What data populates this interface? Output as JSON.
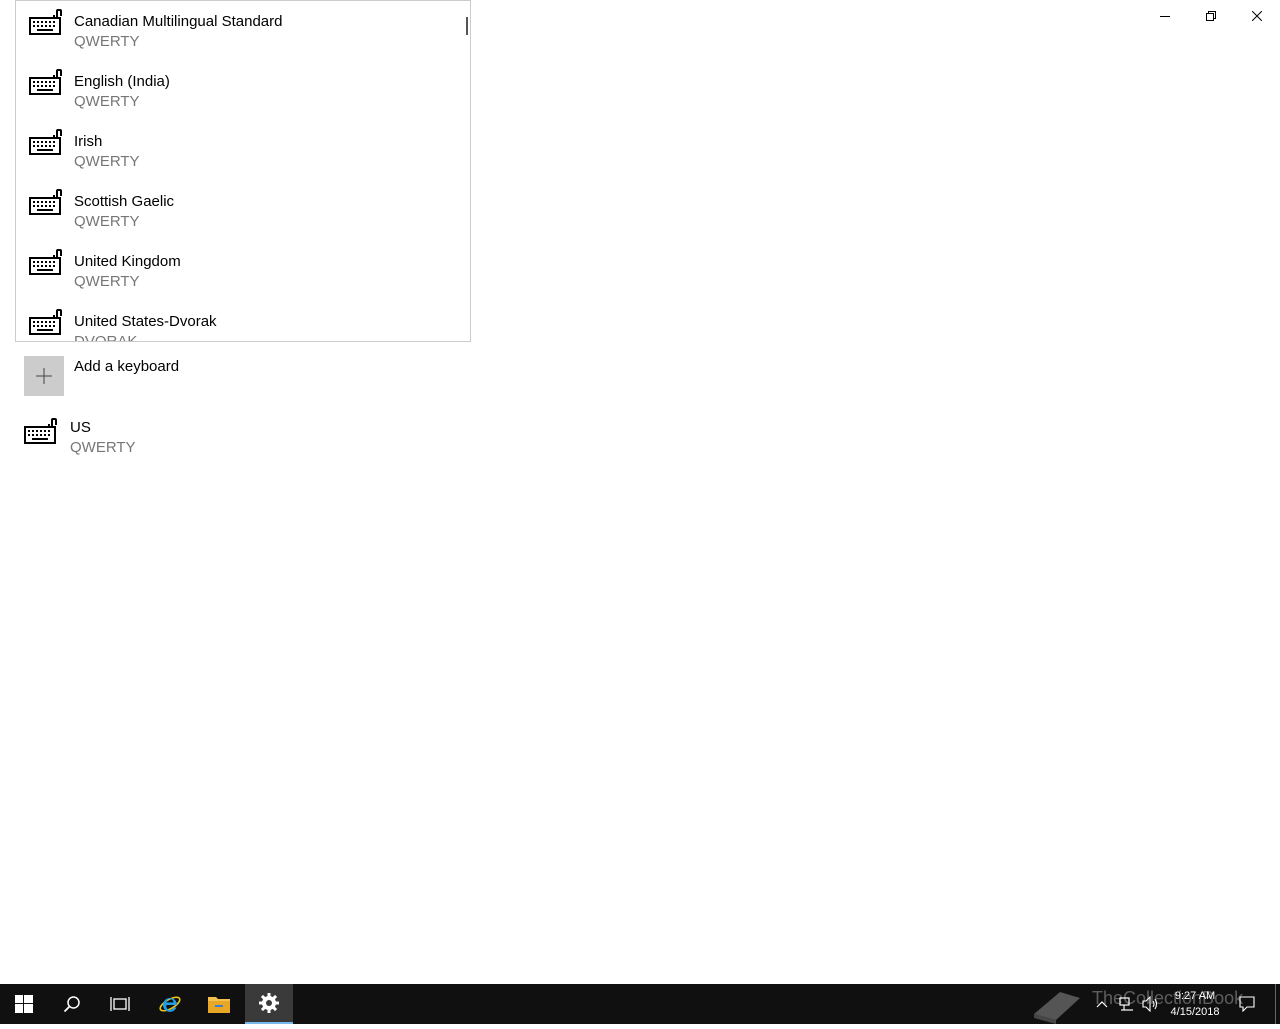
{
  "window": {
    "back_icon": "back-arrow-icon",
    "minimize_icon": "minimize-icon",
    "restore_icon": "restore-icon",
    "close_icon": "close-icon"
  },
  "popup": {
    "items": [
      {
        "name": "Canadian Multilingual Standard",
        "layout": "QWERTY"
      },
      {
        "name": "English (India)",
        "layout": "QWERTY"
      },
      {
        "name": "Irish",
        "layout": "QWERTY"
      },
      {
        "name": "Scottish Gaelic",
        "layout": "QWERTY"
      },
      {
        "name": "United Kingdom",
        "layout": "QWERTY"
      },
      {
        "name": "United States-Dvorak",
        "layout": "DVORAK"
      }
    ]
  },
  "add_keyboard": {
    "label": "Add a keyboard",
    "icon": "plus-icon"
  },
  "installed_keyboard": {
    "name": "US",
    "layout": "QWERTY"
  },
  "taskbar": {
    "start_icon": "windows-start-icon",
    "search_icon": "search-icon",
    "task_view_icon": "task-view-icon",
    "ie_icon": "internet-explorer-icon",
    "explorer_icon": "file-explorer-icon",
    "settings_icon": "gear-icon",
    "tray": {
      "time": "9:27 AM",
      "date": "4/15/2018"
    },
    "watermark": "TheCollectionBook"
  },
  "colors": {
    "taskbar_bg": "#101010",
    "accent": "#76b9ed",
    "plus_box": "#cccccc",
    "secondary_text": "#767676"
  }
}
